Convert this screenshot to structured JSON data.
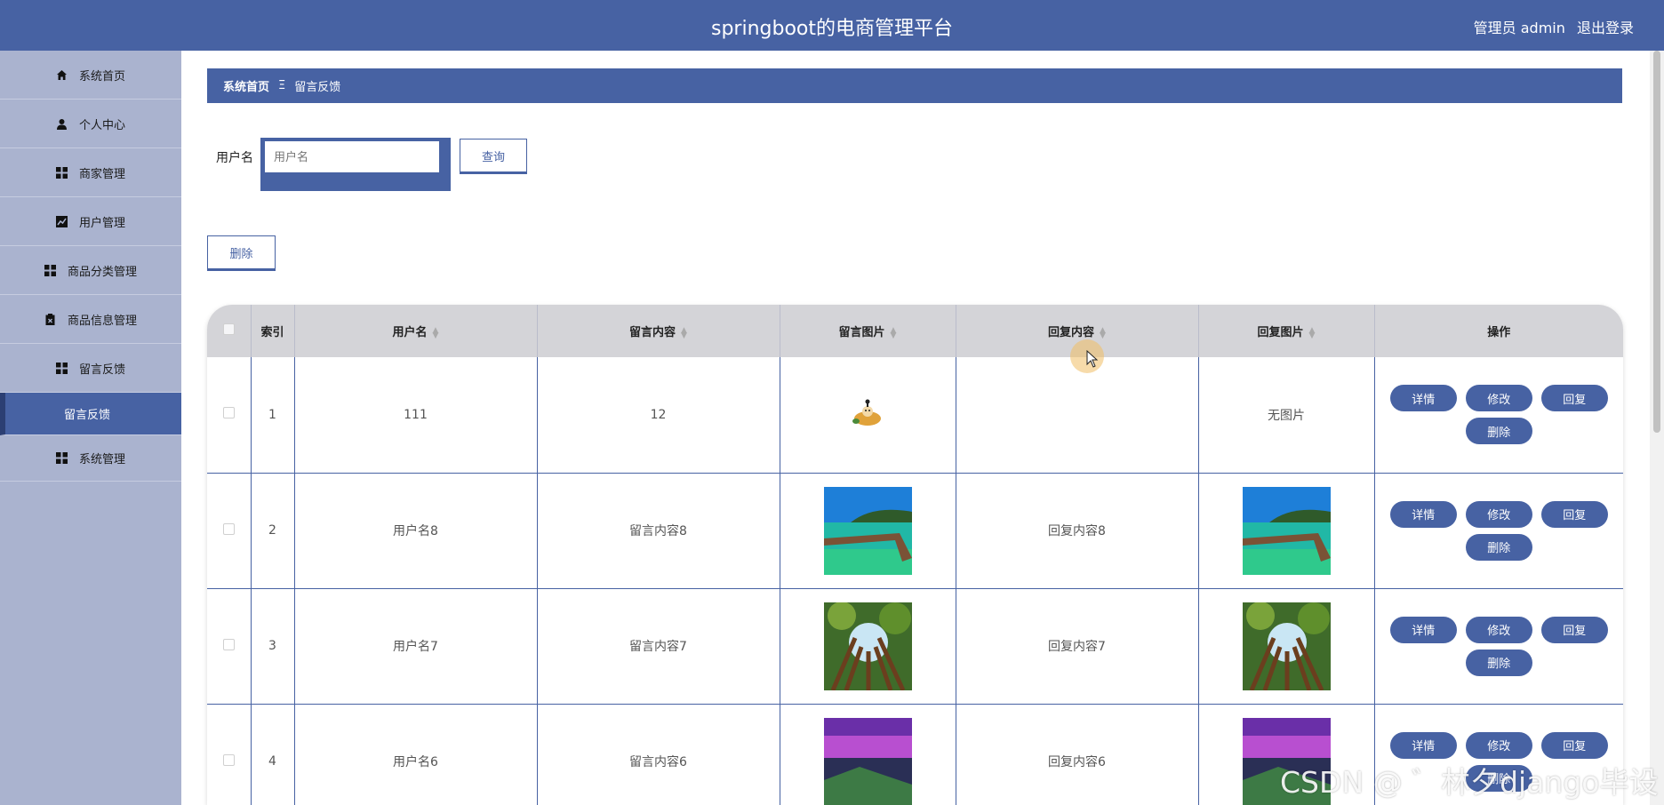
{
  "header": {
    "title": "springboot的电商管理平台",
    "user_label": "管理员 admin",
    "logout": "退出登录"
  },
  "sidebar": {
    "items": [
      {
        "label": "系统首页",
        "icon": "home-icon"
      },
      {
        "label": "个人中心",
        "icon": "user-icon"
      },
      {
        "label": "商家管理",
        "icon": "grid-icon"
      },
      {
        "label": "用户管理",
        "icon": "chart-icon"
      },
      {
        "label": "商品分类管理",
        "icon": "grid-icon"
      },
      {
        "label": "商品信息管理",
        "icon": "clipboard-icon"
      },
      {
        "label": "留言反馈",
        "icon": "grid-icon"
      },
      {
        "label": "留言反馈",
        "icon": ""
      },
      {
        "label": "系统管理",
        "icon": "grid-icon"
      }
    ]
  },
  "breadcrumb": {
    "home": "系统首页",
    "separator": "Ξ",
    "current": "留言反馈"
  },
  "search": {
    "label": "用户名",
    "placeholder": "用户名",
    "button": "查询"
  },
  "toolbar": {
    "delete": "删除"
  },
  "table": {
    "headers": [
      "索引",
      "用户名",
      "留言内容",
      "留言图片",
      "回复内容",
      "回复图片",
      "操作"
    ],
    "rows": [
      {
        "index": "1",
        "username": "111",
        "content": "12",
        "image": "cartoon",
        "reply": "",
        "reply_image": "无图片"
      },
      {
        "index": "2",
        "username": "用户名8",
        "content": "留言内容8",
        "image": "lake-dock",
        "reply": "回复内容8",
        "reply_image": "lake-dock"
      },
      {
        "index": "3",
        "username": "用户名7",
        "content": "留言内容7",
        "image": "forest",
        "reply": "回复内容7",
        "reply_image": "forest"
      },
      {
        "index": "4",
        "username": "用户名6",
        "content": "留言内容6",
        "image": "purple-coast",
        "reply": "回复内容6",
        "reply_image": "purple-coast"
      }
    ],
    "actions": {
      "detail": "详情",
      "edit": "修改",
      "reply": "回复",
      "delete": "删除"
    }
  },
  "watermark": "CSDN @ ゛林夕django毕设",
  "colors": {
    "primary": "#4762a3",
    "sidebar": "#aab3cf",
    "header_row": "#d4d4d8"
  }
}
